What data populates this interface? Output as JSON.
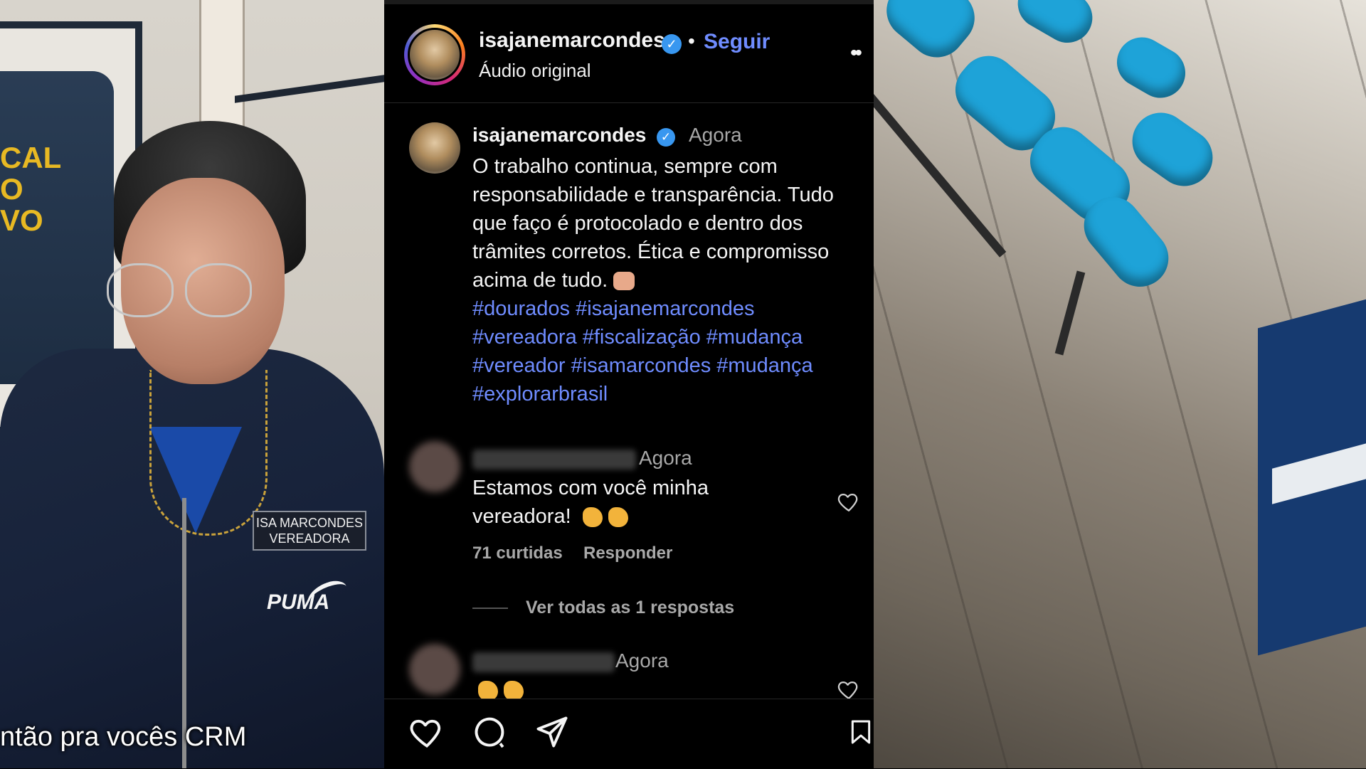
{
  "left_video": {
    "shirt_text": [
      "CAL",
      "O",
      "VO"
    ],
    "badge_line1": "ISA MARCONDES",
    "badge_line2": "VEREADORA",
    "brand": "PUMA",
    "caption": "ntão pra vocês CRM"
  },
  "post": {
    "header": {
      "username": "isajanemarcondes",
      "follow_label": "Seguir",
      "separator": "•",
      "audio": "Áudio original",
      "more_label": "••"
    },
    "caption": {
      "username": "isajanemarcondes",
      "time": "Agora",
      "text": "O trabalho continua, sempre com responsabilidade e transparência. Tudo que faço é protocolado e dentro dos trâmites corretos. Ética e compromisso acima de tudo.",
      "hashtags": [
        "#dourados",
        "#isajanemarcondes",
        "#vereadora",
        "#fiscalização",
        "#mudança",
        "#vereador",
        "#isamarcondes",
        "#mudança",
        "#explorarbrasil"
      ]
    },
    "comments": [
      {
        "time": "Agora",
        "text_line1": "Estamos com você minha",
        "text_line2": "vereadora!",
        "likes": "71 curtidas",
        "reply_label": "Responder",
        "view_replies": "Ver todas as 1 respostas"
      },
      {
        "time": "Agora"
      }
    ]
  },
  "colors": {
    "accent": "#6f8cff",
    "verified": "#3897f0",
    "muted": "#a8a8a8"
  }
}
